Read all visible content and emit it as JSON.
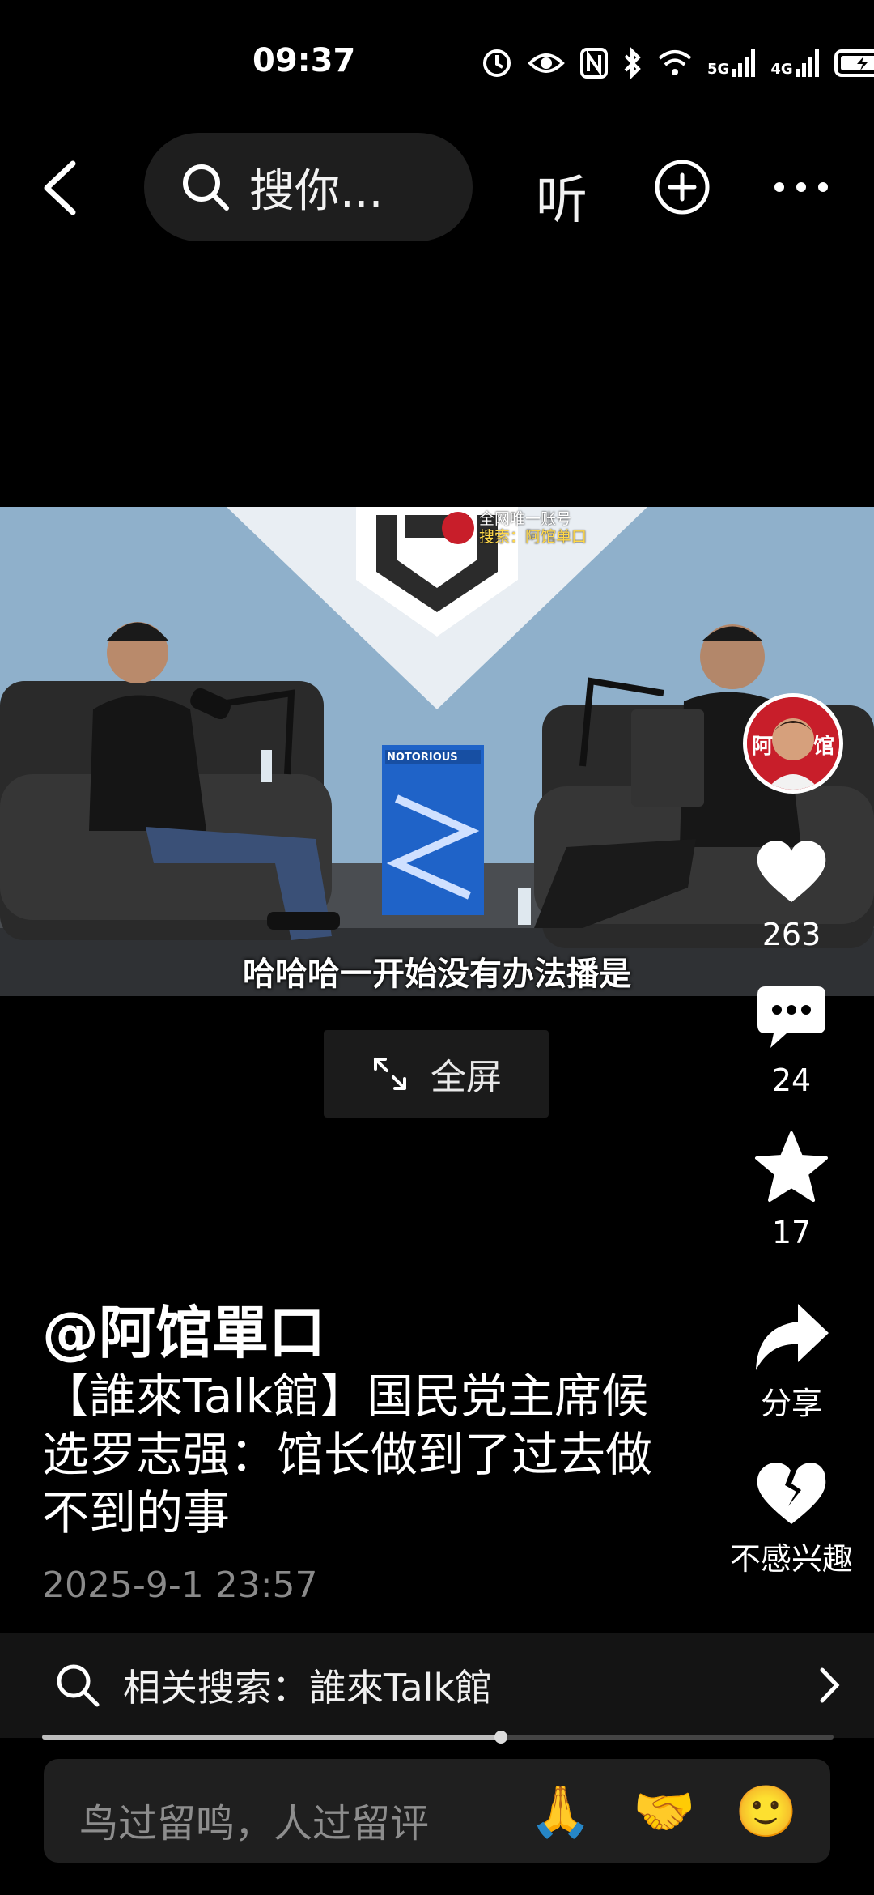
{
  "status_bar": {
    "time": "09:37",
    "network_5g": "5G",
    "network_4g": "4G"
  },
  "header": {
    "search_placeholder": "搜你...",
    "listen_label": "听",
    "icons": [
      "back-arrow-icon",
      "search-icon",
      "plus-circle-icon",
      "more-icon"
    ]
  },
  "video": {
    "watermark_line1": "全网唯一账号",
    "watermark_line2": "搜索：阿馆单口",
    "box_brand": "NOTORIOUS",
    "subtitle": "哈哈哈一开始没有办法播是",
    "fullscreen_label": "全屏"
  },
  "sidebar": {
    "avatar_text_left": "阿",
    "avatar_text_right": "馆",
    "like_count": "263",
    "comment_count": "24",
    "favorite_count": "17",
    "share_label": "分享",
    "dislike_label": "不感兴趣"
  },
  "caption": {
    "author": "@阿馆單口",
    "description": "【誰來Talk館】国民党主席候选罗志强：馆长做到了过去做不到的事",
    "date": "2025-9-1 23:57"
  },
  "related_search": {
    "label": "相关搜索：誰來Talk館"
  },
  "playback": {
    "progress_fraction": 0.58
  },
  "comment_bar": {
    "placeholder": "鸟过留鸣，人过留评",
    "emojis": [
      "🙏",
      "🤝",
      "🙂"
    ]
  }
}
